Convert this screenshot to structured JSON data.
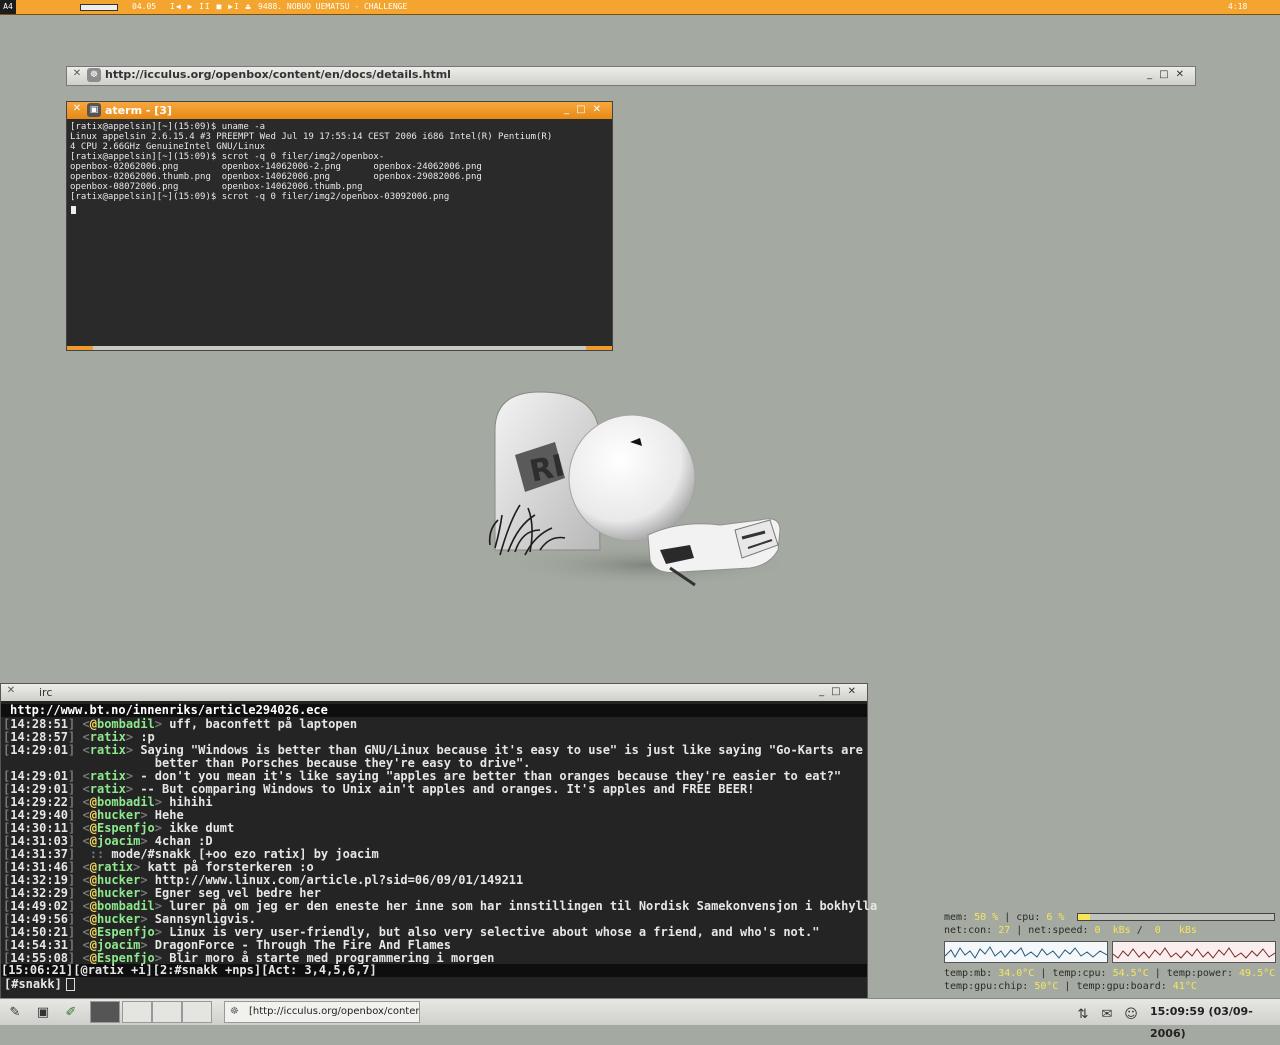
{
  "topbar": {
    "menu_label": "A4",
    "time_elapsed": "04.05",
    "transport": "I◀ ▶ II ■ ▶I ⏏",
    "track": "9488. NOBUO UEMATSU - CHALLENGE",
    "time_right": "4:18"
  },
  "browser": {
    "title": "http://icculus.org/openbox/content/en/docs/details.html"
  },
  "aterm": {
    "title": "aterm - [3]",
    "content": "[ratix@appelsin][~](15:09)$ uname -a\nLinux appelsin 2.6.15.4 #3 PREEMPT Wed Jul 19 17:55:14 CEST 2006 i686 Intel(R) Pentium(R)\n4 CPU 2.66GHz GenuineIntel GNU/Linux\n[ratix@appelsin][~](15:09)$ scrot -q 0 filer/img2/openbox-\nopenbox-02062006.png        openbox-14062006-2.png      openbox-24062006.png\nopenbox-02062006.thumb.png  openbox-14062006.png        openbox-29082006.png\nopenbox-08072006.png        openbox-14062006.thumb.png\n[ratix@appelsin][~](15:09)$ scrot -q 0 filer/img2/openbox-03092006.png"
  },
  "irc": {
    "title": "irc",
    "topic": "http://www.bt.no/innenriks/article294026.ece",
    "lines": [
      {
        "time": "14:28:51",
        "op": "@",
        "nick": "bombadil",
        "text": "uff, baconfett på laptopen"
      },
      {
        "time": "14:28:57",
        "op": "",
        "nick": "ratix",
        "text": ":p"
      },
      {
        "time": "14:29:01",
        "op": "",
        "nick": "ratix",
        "text": "Saying \"Windows is better than GNU/Linux because it's easy to use\" is just like saying \"Go-Karts are"
      },
      {
        "time": "",
        "op": "",
        "nick": "",
        "text": "better than Porsches because they're easy to drive\"."
      },
      {
        "time": "14:29:01",
        "op": "",
        "nick": "ratix",
        "text": "- don't you mean it's like saying \"apples are better than oranges because they're easier to eat?\""
      },
      {
        "time": "14:29:01",
        "op": "",
        "nick": "ratix",
        "text": "-- But comparing Windows to Unix ain't apples and oranges. It's apples and FREE BEER!"
      },
      {
        "time": "14:29:22",
        "op": "@",
        "nick": "bombadil",
        "text": "hihihi"
      },
      {
        "time": "14:29:40",
        "op": "@",
        "nick": "hucker",
        "text": "Hehe"
      },
      {
        "time": "14:30:11",
        "op": "@",
        "nick": "Espenfjo",
        "text": "ikke dumt"
      },
      {
        "time": "14:31:03",
        "op": "@",
        "nick": "joacim",
        "text": "4chan :D"
      },
      {
        "time": "14:31:37",
        "op": "",
        "nick": "",
        "text": "mode/#snakk [+oo ezo ratix] by joacim"
      },
      {
        "time": "14:31:46",
        "op": "@",
        "nick": "ratix",
        "text": "katt på forsterkeren :o"
      },
      {
        "time": "14:32:19",
        "op": "@",
        "nick": "hucker",
        "text": "http://www.linux.com/article.pl?sid=06/09/01/149211"
      },
      {
        "time": "14:32:29",
        "op": "@",
        "nick": "hucker",
        "text": "Egner seg vel bedre her"
      },
      {
        "time": "14:49:02",
        "op": "@",
        "nick": "bombadil",
        "text": "lurer på om jeg er den eneste her inne som har innstillingen til Nordisk Samekonvensjon i bokhylla"
      },
      {
        "time": "14:49:56",
        "op": "@",
        "nick": "hucker",
        "text": "Sannsynligvis."
      },
      {
        "time": "14:50:21",
        "op": "@",
        "nick": "Espenfjo",
        "text": "Linux is very user-friendly, but also very selective about whose a friend, and who's not.\""
      },
      {
        "time": "14:54:31",
        "op": "@",
        "nick": "joacim",
        "text": "DragonForce - Through The Fire And Flames"
      },
      {
        "time": "14:55:08",
        "op": "@",
        "nick": "Espenfjo",
        "text": "Blir moro å starte med programmering i morgen"
      }
    ],
    "status": "[15:06:21][@ratix +i][2:#snakk +nps][Act: 3,4,5,6,7]",
    "input_prompt": "[#snakk]"
  },
  "sysmon": {
    "mem": "50 %",
    "cpu": "6 %",
    "cpu_fraction": 0.06,
    "net_con": "27",
    "net_in": "0",
    "net_out": "0",
    "unit": "kBs",
    "temp_mb": "34.0°C",
    "temp_cpu": "54.5°C",
    "temp_power": "49.5°C",
    "temp_gpu_chip": "50°C",
    "temp_gpu_board": "41°C"
  },
  "taskbar": {
    "task_label": "[http://icculus.org/openbox/content/",
    "clock": "15:09:59 (03/09-2006)"
  },
  "colors": {
    "accent_orange": "#f3a52f",
    "desktop": "#a4aaa1",
    "terminal_bg": "#292a29",
    "irc_green": "#8ee88e",
    "irc_yellow": "#f0d65e",
    "monitor_yellow": "#f6e55a"
  }
}
